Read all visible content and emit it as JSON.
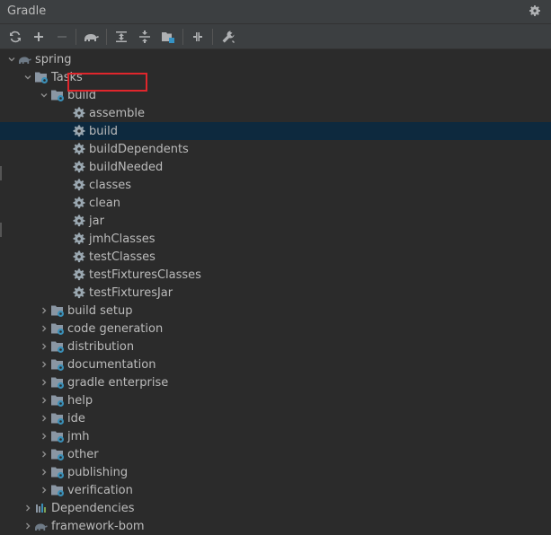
{
  "window": {
    "title": "Gradle"
  },
  "toolbar": {
    "buttons": [
      {
        "icon": "refresh-icon",
        "name": "reload-button"
      },
      {
        "icon": "plus-icon",
        "name": "link-project-button"
      },
      {
        "icon": "minus-icon",
        "name": "unlink-project-button"
      },
      {
        "icon": "elephant-icon",
        "name": "execute-task-button"
      },
      {
        "icon": "expand-all-icon",
        "name": "expand-all-button"
      },
      {
        "icon": "collapse-all-icon",
        "name": "collapse-all-button"
      },
      {
        "icon": "group-modules-icon",
        "name": "group-button"
      },
      {
        "icon": "offline-icon",
        "name": "offline-mode-button"
      },
      {
        "icon": "wrench-icon",
        "name": "build-tool-settings-button"
      }
    ]
  },
  "tree": {
    "root": "spring",
    "tasks": "Tasks",
    "build_group": "build",
    "build_tasks": [
      "assemble",
      "build",
      "buildDependents",
      "buildNeeded",
      "classes",
      "clean",
      "jar",
      "jmhClasses",
      "testClasses",
      "testFixturesClasses",
      "testFixturesJar"
    ],
    "groups": [
      "build setup",
      "code generation",
      "distribution",
      "documentation",
      "gradle enterprise",
      "help",
      "ide",
      "jmh",
      "other",
      "publishing",
      "verification"
    ],
    "dependencies": "Dependencies",
    "framework_bom": "framework-bom",
    "selected": "build"
  },
  "colors": {
    "background": "#2b2b2b",
    "selection": "#0d293e",
    "highlight_box": "#e0262c",
    "gradle_icon": "#6e7a86",
    "folder": "#8a96a3",
    "task_gear": "#9aa7b0"
  }
}
